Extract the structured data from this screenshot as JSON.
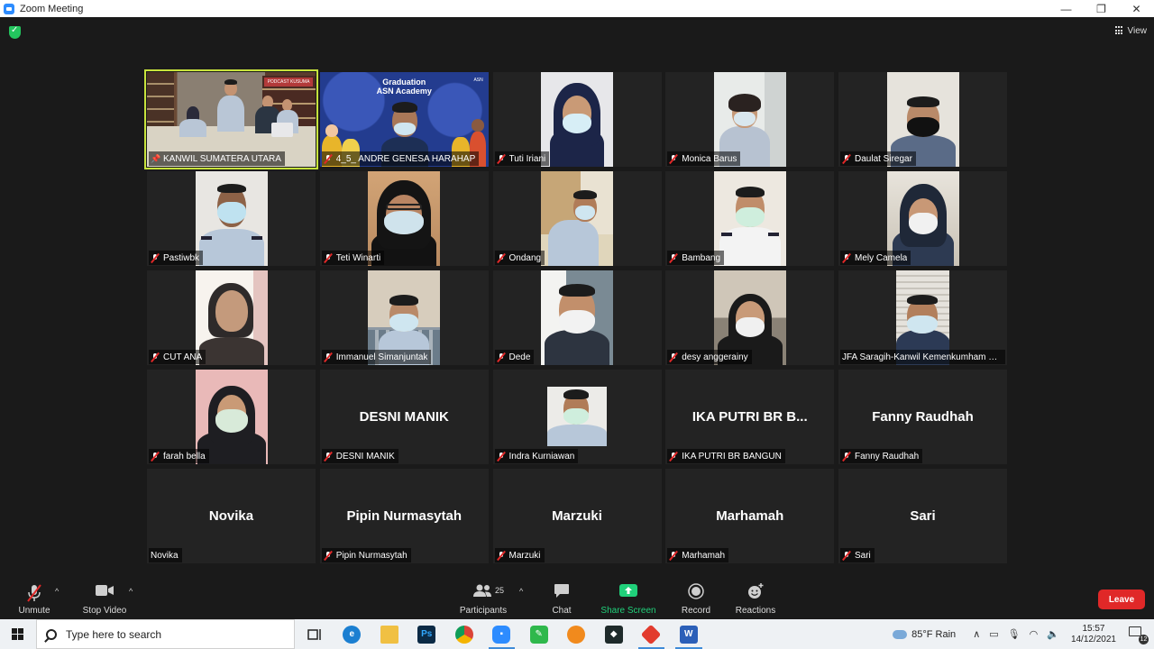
{
  "window": {
    "title": "Zoom Meeting",
    "controls": [
      "—",
      "❐",
      "✕"
    ]
  },
  "top": {
    "view_label": "View"
  },
  "participants": [
    {
      "name": "KANWIL SUMATERA UTARA",
      "video": true,
      "scene": "office",
      "active": true,
      "status": "pinned"
    },
    {
      "name": "4_5_ ANDRE GENESA HARAHAP",
      "video": true,
      "scene": "graduation",
      "status": "muted",
      "banner_title": "Graduation",
      "banner_sub": "ASN Academy",
      "banner_logo": "ASN"
    },
    {
      "name": "Tuti Iriani",
      "video": true,
      "scene": "hijab-navy",
      "status": "muted"
    },
    {
      "name": "Monica Barus",
      "video": true,
      "scene": "woman-short",
      "status": "muted"
    },
    {
      "name": "Daulat Siregar",
      "video": true,
      "scene": "man-black-mask",
      "status": "muted"
    },
    {
      "name": "Pastiwbk",
      "video": true,
      "scene": "man-uniform",
      "status": "muted"
    },
    {
      "name": "Teti Winarti",
      "video": true,
      "scene": "hijab-black-glasses",
      "status": "muted"
    },
    {
      "name": "Ondang",
      "video": true,
      "scene": "man-office",
      "status": "muted"
    },
    {
      "name": "Bambang",
      "video": true,
      "scene": "man-white-uniform",
      "status": "muted"
    },
    {
      "name": "Mely Camela",
      "video": true,
      "scene": "hijab-dark",
      "status": "muted"
    },
    {
      "name": "CUT ANA",
      "video": true,
      "scene": "woman-bright",
      "status": "muted"
    },
    {
      "name": "Immanuel Simanjuntak",
      "video": true,
      "scene": "man-shelves",
      "status": "muted"
    },
    {
      "name": "Dede",
      "video": true,
      "scene": "man-window",
      "status": "muted"
    },
    {
      "name": "desy anggerainy",
      "video": true,
      "scene": "woman-car",
      "status": "muted"
    },
    {
      "name": "JFA Saragih-Kanwil Kemenkumham S...",
      "video": true,
      "scene": "man-blinds",
      "status": "none"
    },
    {
      "name": "farah bella",
      "video": true,
      "scene": "hijab-pink",
      "status": "muted"
    },
    {
      "name": "DESNI MANIK",
      "video": false,
      "display": "DESNI MANIK",
      "status": "muted"
    },
    {
      "name": "Indra Kurniawan",
      "video": true,
      "scene": "man-small",
      "status": "muted"
    },
    {
      "name": "IKA PUTRI BR BANGUN",
      "video": false,
      "display": "IKA PUTRI BR B...",
      "status": "muted"
    },
    {
      "name": "Fanny Raudhah",
      "video": false,
      "display": "Fanny Raudhah",
      "status": "muted"
    },
    {
      "name": "Novika",
      "video": false,
      "display": "Novika",
      "status": "none"
    },
    {
      "name": "Pipin Nurmasytah",
      "video": false,
      "display": "Pipin Nurmasytah",
      "status": "muted"
    },
    {
      "name": "Marzuki",
      "video": false,
      "display": "Marzuki",
      "status": "muted"
    },
    {
      "name": "Marhamah",
      "video": false,
      "display": "Marhamah",
      "status": "muted"
    },
    {
      "name": "Sari",
      "video": false,
      "display": "Sari",
      "status": "muted"
    }
  ],
  "toolbar": {
    "unmute": "Unmute",
    "stop_video": "Stop Video",
    "participants": "Participants",
    "participants_count": "25",
    "chat": "Chat",
    "share_screen": "Share Screen",
    "record": "Record",
    "reactions": "Reactions",
    "leave": "Leave",
    "accent_green": "#20d07a",
    "leave_color": "#e02828"
  },
  "taskbar": {
    "search_placeholder": "Type here to search",
    "apps": [
      "task-view",
      "edge",
      "file-explorer",
      "photoshop",
      "chrome",
      "zoom",
      "green-app",
      "orange-app",
      "capcut",
      "red-app",
      "word"
    ],
    "weather": "85°F  Rain",
    "time": "15:57",
    "date": "14/12/2021",
    "notifications": "12"
  }
}
